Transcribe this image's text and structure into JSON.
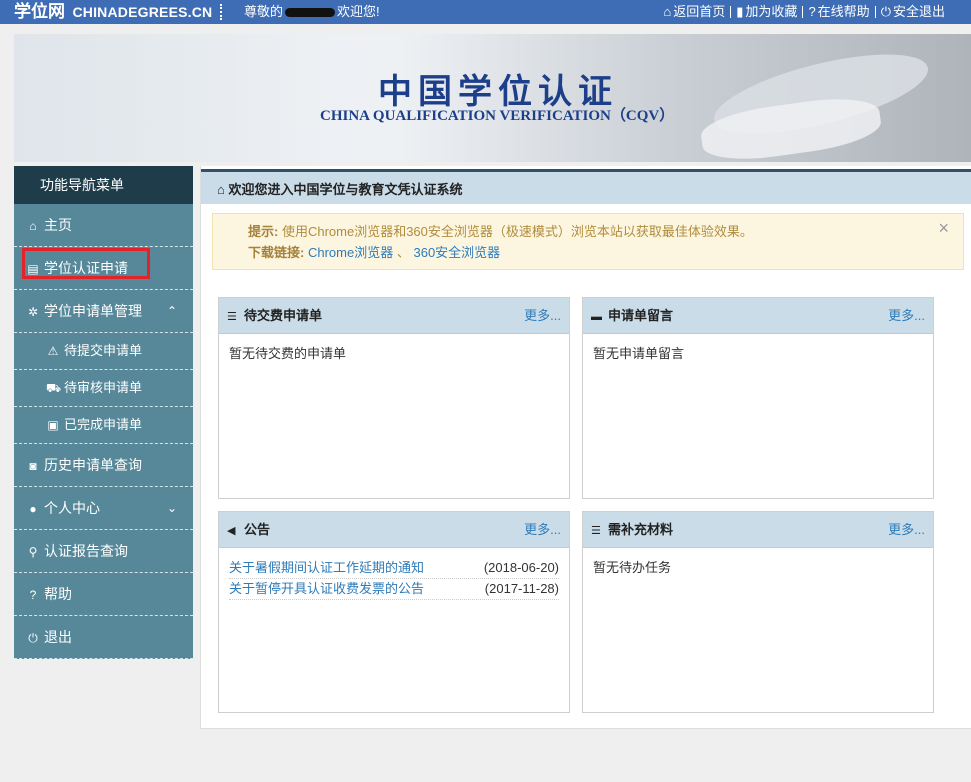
{
  "topbar": {
    "brand_cn": "学位网",
    "brand_en": "CHINADEGREES.CN",
    "greeting_prefix": "尊敬的",
    "greeting_suffix": "欢迎您!",
    "nav": [
      {
        "icon": "home-icon",
        "glyph": "⌂",
        "label": "返回首页"
      },
      {
        "icon": "bookmark-icon",
        "glyph": "▮",
        "label": "加为收藏"
      },
      {
        "icon": "help-icon",
        "glyph": "?",
        "label": "在线帮助"
      },
      {
        "icon": "power-icon",
        "glyph": "⏻",
        "label": "安全退出"
      }
    ]
  },
  "banner": {
    "title_cn": "中国学位认证",
    "title_en": "CHINA QUALIFICATION VERIFICATION（CQV）"
  },
  "sidebar": {
    "header": "功能导航菜单",
    "items": [
      {
        "label": "主页",
        "glyph": "⌂"
      },
      {
        "label": "学位认证申请",
        "glyph": "▤"
      },
      {
        "label": "学位申请单管理",
        "glyph": "✲",
        "caret": "⌃"
      },
      {
        "label": "待提交申请单",
        "glyph": "⚠"
      },
      {
        "label": "待审核申请单",
        "glyph": "⛟"
      },
      {
        "label": "已完成申请单",
        "glyph": "▣"
      },
      {
        "label": "历史申请单查询",
        "glyph": "◙"
      },
      {
        "label": "个人中心",
        "glyph": "●",
        "caret": "⌄"
      },
      {
        "label": "认证报告查询",
        "glyph": "⚲"
      },
      {
        "label": "帮助",
        "glyph": "?"
      },
      {
        "label": "退出",
        "glyph": "⏻"
      }
    ]
  },
  "main": {
    "header": "欢迎您进入中国学位与教育文凭认证系统",
    "tip": {
      "label": "提示:",
      "text": "使用Chrome浏览器和360安全浏览器（极速模式）浏览本站以获取最佳体验效果。",
      "download_label": "下载链接:",
      "link1": "Chrome浏览器",
      "link_sep": "、",
      "link2": "360安全浏览器",
      "close": "×"
    },
    "cards": {
      "pending_payment": {
        "title": "待交费申请单",
        "more": "更多...",
        "empty": "暂无待交费的申请单"
      },
      "messages": {
        "title": "申请单留言",
        "more": "更多...",
        "empty": "暂无申请单留言"
      },
      "announcements": {
        "title": "公告",
        "more": "更多...",
        "items": [
          {
            "title": "关于暑假期间认证工作延期的通知",
            "date": "(2018-06-20)"
          },
          {
            "title": "关于暂停开具认证收费发票的公告",
            "date": "(2017-11-28)"
          }
        ]
      },
      "supplements": {
        "title": "需补充材料",
        "more": "更多...",
        "empty": "暂无待办任务"
      }
    }
  },
  "colors": {
    "topbar": "#3e6db5",
    "sidebar": "#56889a",
    "sidebar_header": "#1f3c4a",
    "panel_header": "#c9dce8",
    "link": "#2e7bb8",
    "highlight": "#e3232a"
  }
}
